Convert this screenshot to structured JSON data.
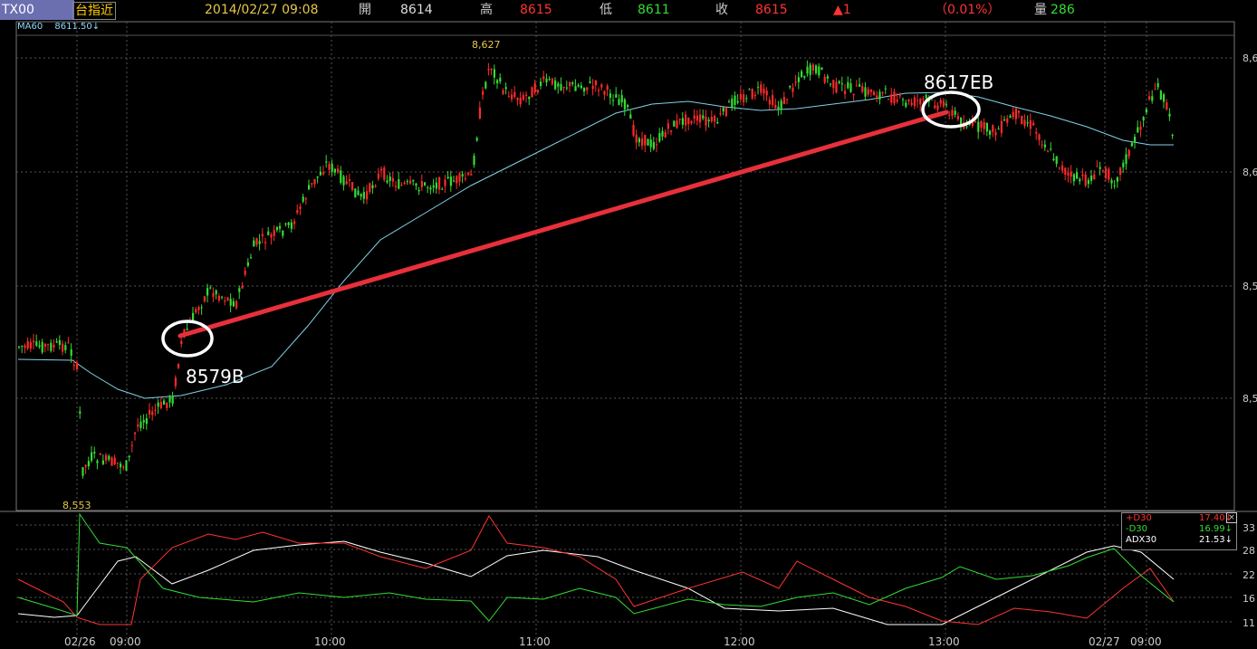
{
  "header": {
    "symbol": "TX00",
    "name": "台指近",
    "datetime": "2014/02/27 09:08",
    "open_label": "開",
    "open_value": "8614",
    "high_label": "高",
    "high_value": "8615",
    "low_label": "低",
    "low_value": "8611",
    "close_label": "收",
    "close_value": "8615",
    "change": "▲1",
    "change_pct": "（0.01%）",
    "volume_label": "量",
    "volume_value": "286"
  },
  "ma_indicator": {
    "label": "MA60",
    "value": "8611.50↓"
  },
  "chart_data": [
    {
      "type": "candlestick",
      "title": "",
      "y_axis_ticks": [
        "8,6",
        "8,6",
        "8,5",
        "8,5"
      ],
      "x_axis_ticks": [
        "02/26",
        "09:00",
        "10:00",
        "11:00",
        "12:00",
        "13:00",
        "02/27",
        "09:00"
      ],
      "ylim": [
        8545,
        8630
      ],
      "price_annotations": [
        "8,627",
        "8,553"
      ],
      "overlay_series": [
        {
          "name": "MA60",
          "last_value": 8611.5
        }
      ],
      "trade_annotations": [
        "8579B",
        "8617EB"
      ],
      "trade_line": {
        "from": {
          "x": "09:20",
          "y": 8579
        },
        "to": {
          "x": "13:00",
          "y": 8617
        }
      }
    },
    {
      "type": "line",
      "title": "",
      "y_axis_ticks": [
        "33",
        "28",
        "22",
        "16",
        "11"
      ],
      "series": [
        {
          "name": "+D30",
          "value": "17.40↓",
          "color": "#ff3333"
        },
        {
          "name": "-D30",
          "value": "16.99↓",
          "color": "#33dd33"
        },
        {
          "name": "ADX30",
          "value": "21.53↓",
          "color": "#ffffff"
        }
      ]
    }
  ],
  "colors": {
    "up": "#ff2a2a",
    "down": "#33dd33",
    "ma": "#7fd3e6",
    "trade_line": "#e8303a",
    "grid": "#555555"
  },
  "icons": {
    "close": "close-icon"
  }
}
